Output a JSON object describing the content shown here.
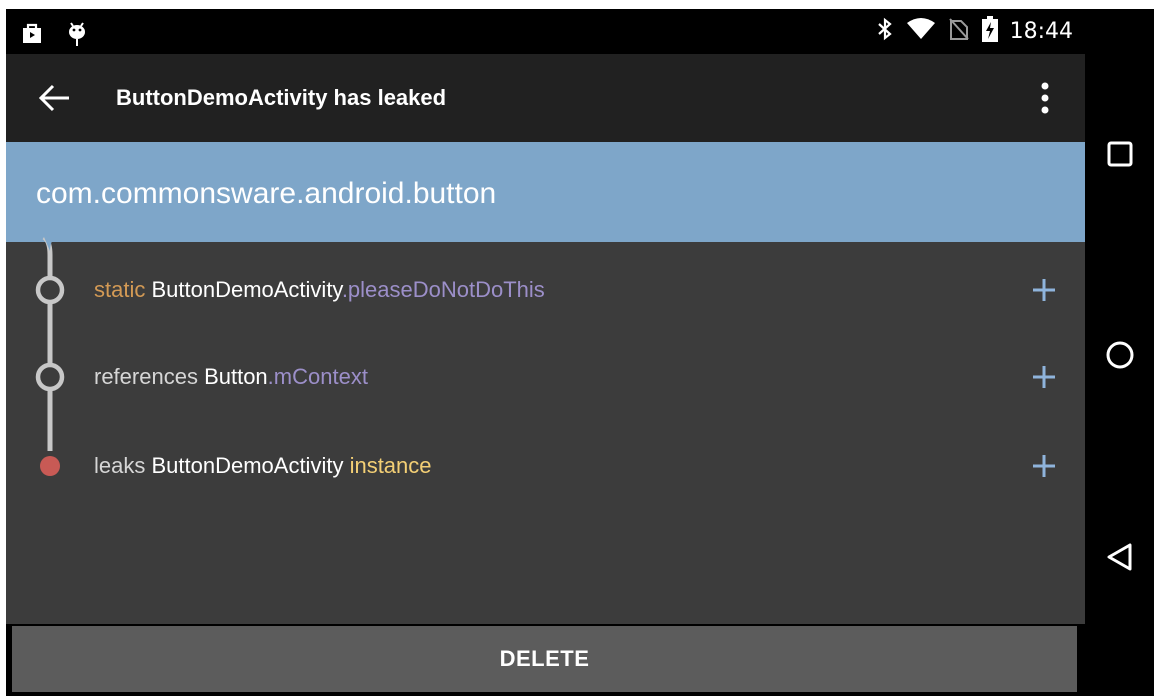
{
  "status_bar": {
    "time": "18:44",
    "left_icons": [
      "shopping-bag-icon",
      "android-debug-icon"
    ],
    "right_icons": [
      "bluetooth-icon",
      "wifi-icon",
      "no-sim-icon",
      "battery-charging-icon"
    ]
  },
  "app_bar": {
    "title": "ButtonDemoActivity has leaked",
    "back_icon": "arrow-left-icon",
    "menu_icon": "more-vert-icon"
  },
  "header": {
    "package": "com.commonsware.android.button"
  },
  "trace": [
    {
      "node": "hollow",
      "parts": [
        {
          "text": "static ",
          "style": "keyword"
        },
        {
          "text": "ButtonDemoActivity",
          "style": "class"
        },
        {
          "text": ".pleaseDoNotDoThis",
          "style": "field"
        }
      ]
    },
    {
      "node": "hollow",
      "parts": [
        {
          "text": "references ",
          "style": "muted"
        },
        {
          "text": "Button",
          "style": "class"
        },
        {
          "text": ".mContext",
          "style": "field"
        }
      ]
    },
    {
      "node": "leak",
      "parts": [
        {
          "text": "leaks ",
          "style": "muted"
        },
        {
          "text": "ButtonDemoActivity",
          "style": "class"
        },
        {
          "text": " instance",
          "style": "instance"
        }
      ]
    }
  ],
  "expand_icon": "plus-icon",
  "delete_label": "DELETE",
  "nav_bar": [
    "recents-square-icon",
    "home-circle-icon",
    "back-triangle-icon"
  ],
  "colors": {
    "header_band": "#7ea6c9",
    "content_bg": "#3c3c3c",
    "app_bar": "#212121",
    "keyword": "#d39a55",
    "field": "#9c8fc9",
    "instance": "#f3cf75",
    "plus": "#8fb4dc",
    "leak_dot": "#c85a55",
    "tree_line": "#c8c8c8",
    "delete_button": "#5c5c5c"
  }
}
